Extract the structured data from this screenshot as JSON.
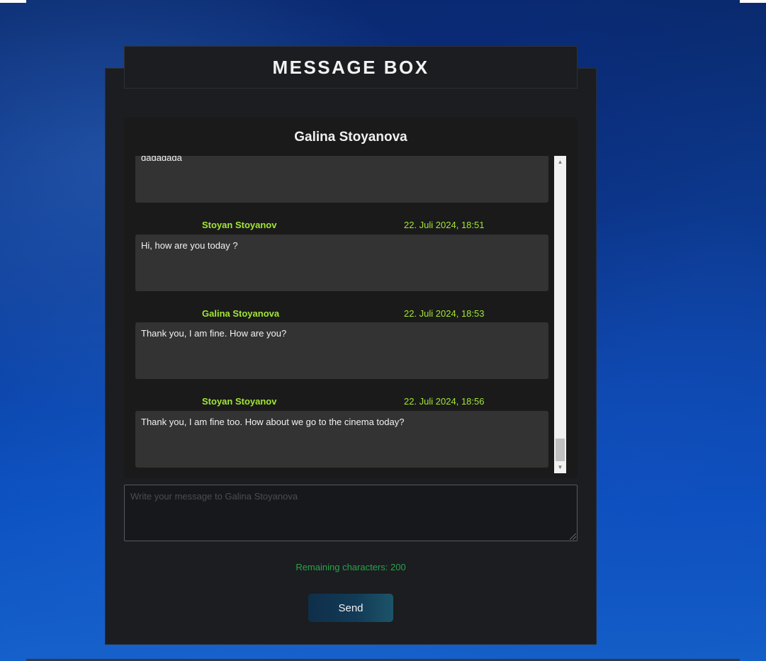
{
  "header": {
    "title": "MESSAGE BOX"
  },
  "conversation": {
    "title": "Galina Stoyanova",
    "partial_message": {
      "text": "dadadada"
    },
    "messages": [
      {
        "sender": "Stoyan Stoyanov",
        "timestamp": "22. Juli 2024, 18:51",
        "text": "Hi, how are you today ?"
      },
      {
        "sender": "Galina Stoyanova",
        "timestamp": "22. Juli 2024, 18:53",
        "text": "Thank you, I am fine. How are you?"
      },
      {
        "sender": "Stoyan Stoyanov",
        "timestamp": "22. Juli 2024, 18:56",
        "text": "Thank you, I am fine too. How about we go to the cinema today?"
      }
    ]
  },
  "compose": {
    "placeholder": "Write your message to Galina Stoyanova",
    "value": ""
  },
  "remaining": {
    "text": "Remaining characters: 200"
  },
  "send": {
    "label": "Send"
  },
  "colors": {
    "accent_green": "#a3e635",
    "remaining_green": "#2aa34a",
    "panel_bg": "#1b1d20",
    "bubble_bg": "#333333"
  },
  "icons": {
    "scroll_up": "triangle-up",
    "scroll_down": "triangle-down"
  }
}
